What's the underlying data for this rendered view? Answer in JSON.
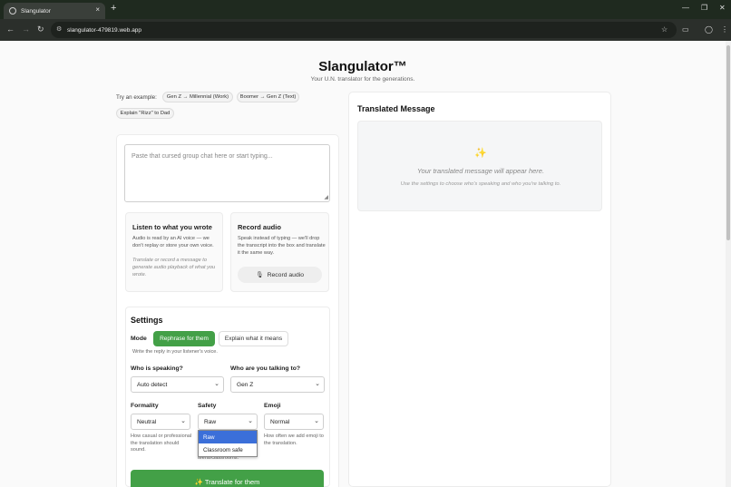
{
  "browser": {
    "tab_title": "Slangulator",
    "url": "slangulator-479819.web.app",
    "new_tab": "+",
    "tab_close": "×"
  },
  "header": {
    "title": "Slangulator™",
    "subtitle": "Your U.N. translator for the generations."
  },
  "examples": {
    "label": "Try an example:",
    "chips": [
      "Gen Z → Millennial (Work)",
      "Boomer → Gen Z (Text)",
      "Explain \"Rizz\" to Dad"
    ]
  },
  "input": {
    "placeholder": "Paste that cursed group chat here or start typing..."
  },
  "listen": {
    "title": "Listen to what you wrote",
    "description": "Audio is read by an AI voice — we don't replay or store your own voice.",
    "hint": "Translate or record a message to generate audio playback of what you wrote."
  },
  "record": {
    "title": "Record audio",
    "description": "Speak instead of typing — we'll drop the transcript into the box and translate it the same way.",
    "button_label": "Record audio",
    "button_icon": "microphone-icon"
  },
  "settings": {
    "title": "Settings",
    "mode_label": "Mode",
    "mode_options": [
      "Rephrase for them",
      "Explain what it means"
    ],
    "mode_selected": "Rephrase for them",
    "mode_hint": "Write the reply in your listener's voice.",
    "speaker_label": "Who is speaking?",
    "speaker_value": "Auto detect",
    "listener_label": "Who are you talking to?",
    "listener_value": "Gen Z",
    "formality_label": "Formality",
    "formality_value": "Neutral",
    "formality_hint": "How casual or professional the translation should sound.",
    "safety_label": "Safety",
    "safety_value": "Raw",
    "safety_options": [
      "Raw",
      "Classroom safe"
    ],
    "safety_hint_partial": "teens/classrooms.",
    "emoji_label": "Emoji",
    "emoji_value": "Normal",
    "emoji_hint": "How often we add emoji to the translation.",
    "translate_button": "✨ Translate for them"
  },
  "output": {
    "title": "Translated Message",
    "icon": "sparkles-icon",
    "placeholder": "Your translated message will appear here.",
    "hint": "Use the settings to choose who's speaking and who you're talking to."
  },
  "colors": {
    "accent": "#43a047",
    "dropdown_highlight": "#3b6fd9"
  }
}
